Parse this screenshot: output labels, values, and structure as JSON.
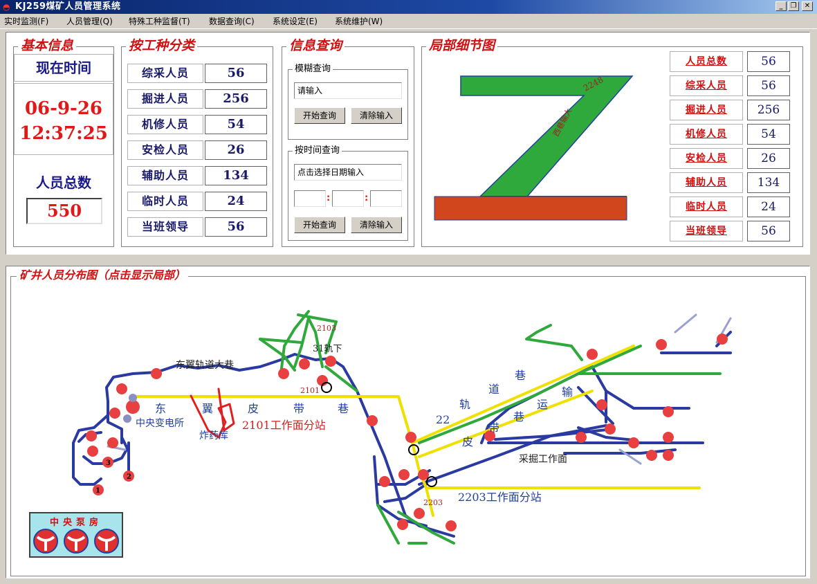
{
  "window": {
    "title": "KJ259煤矿人员管理系统",
    "minimize_glyph": "_",
    "maximize_glyph": "❐",
    "close_glyph": "✕"
  },
  "menu": [
    {
      "label": "实时监测(F)"
    },
    {
      "label": "人员管理(Q)"
    },
    {
      "label": "特殊工种监督(T)"
    },
    {
      "label": "数据查询(C)"
    },
    {
      "label": "系统设定(E)"
    },
    {
      "label": "系统维护(W)"
    }
  ],
  "basic_info": {
    "title": "基本信息",
    "time_label": "现在时间",
    "date": "06-9-26",
    "time": "12:37:25",
    "total_label": "人员总数",
    "total_value": "550"
  },
  "by_type": {
    "title": "按工种分类",
    "rows": [
      {
        "label": "综采人员",
        "value": "56"
      },
      {
        "label": "掘进人员",
        "value": "256"
      },
      {
        "label": "机修人员",
        "value": "54"
      },
      {
        "label": "安检人员",
        "value": "26"
      },
      {
        "label": "辅助人员",
        "value": "134"
      },
      {
        "label": "临时人员",
        "value": "24"
      },
      {
        "label": "当班领导",
        "value": "56"
      }
    ]
  },
  "query": {
    "title": "信息查询",
    "fuzzy": {
      "title": "模糊查询",
      "input_value": "请输入",
      "start_button": "开始查询",
      "clear_button": "清除输入"
    },
    "by_time": {
      "title": "按时间查询",
      "input_value": "点击选择日期输入",
      "separator": ":",
      "start_button": "开始查询",
      "clear_button": "清除输入"
    }
  },
  "detail": {
    "title": "局部细节图",
    "road_label": "西巷输大",
    "node_label": "2248",
    "legend": [
      {
        "label": "人员总数",
        "value": "56"
      },
      {
        "label": "综采人员",
        "value": "56"
      },
      {
        "label": "掘进人员",
        "value": "256"
      },
      {
        "label": "机修人员",
        "value": "54"
      },
      {
        "label": "安检人员",
        "value": "26"
      },
      {
        "label": "辅助人员",
        "value": "134"
      },
      {
        "label": "临时人员",
        "value": "24"
      },
      {
        "label": "当班领导",
        "value": "56"
      }
    ],
    "colors": {
      "green": "#2fa83c",
      "orange": "#d2461e",
      "blue": "#2040a0"
    }
  },
  "mine_map": {
    "title": "矿井人员分布图（点击显示局部）",
    "labels": {
      "east_wing_track": "东翼轨道大巷",
      "belt_chars": [
        "东",
        "翼",
        "皮",
        "带",
        "巷"
      ],
      "central_substation": "中央变电所",
      "explosives": "炸药库",
      "station_2101": "2101工作面分站",
      "node_2101": "2101",
      "node_2103": "2103",
      "track_31": "31轨下",
      "track22_chars": [
        "22",
        "轨",
        "道",
        "巷"
      ],
      "convey_chars": [
        "皮",
        "带",
        "巷",
        "运",
        "输"
      ],
      "mining_face": "采掘工作面",
      "node_2203": "2203",
      "station_2203": "2203工作面分站",
      "num_1": "1",
      "num_2": "2",
      "num_3": "3",
      "pump_room": "中央泵房"
    },
    "colors": {
      "track": "#2a3aa0",
      "belt": "#f0e000",
      "green": "#2fa83c",
      "red_route": "#e02020",
      "person": "#e84040"
    }
  }
}
